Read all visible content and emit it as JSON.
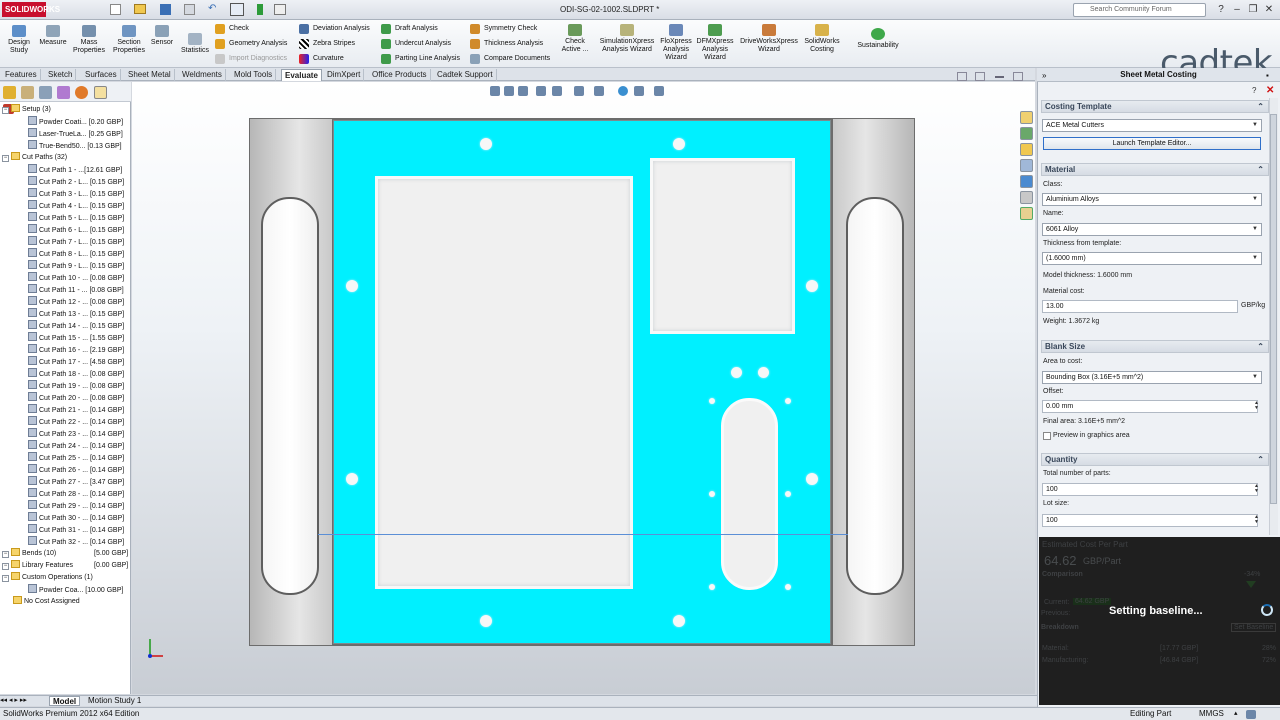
{
  "app": {
    "logo": "SOLIDWORKS",
    "doc_title": "ODI-SG-02-1002.SLDPRT *",
    "search_placeholder": "Search Community Forum",
    "brand": "cadtek"
  },
  "window_buttons": [
    "?",
    "–",
    "❐",
    "✕"
  ],
  "ribbon": {
    "big_buttons": [
      {
        "label": "Design Study"
      },
      {
        "label": "Measure"
      },
      {
        "label": "Mass Properties"
      },
      {
        "label": "Section Properties"
      },
      {
        "label": "Sensor"
      },
      {
        "label": "Statistics"
      }
    ],
    "group1": [
      "Check",
      "Geometry Analysis",
      "Import Diagnostics"
    ],
    "group2": [
      "Deviation Analysis",
      "Zebra Stripes",
      "Curvature"
    ],
    "group3": [
      "Draft Analysis",
      "Undercut Analysis",
      "Parting Line Analysis"
    ],
    "group4": [
      "Symmetry Check",
      "Thickness Analysis",
      "Compare Documents"
    ],
    "right_buttons": [
      {
        "label": "Check Active ..."
      },
      {
        "label": "SimulationXpress Analysis Wizard"
      },
      {
        "label": "FloXpress Analysis Wizard"
      },
      {
        "label": "DFMXpress Analysis Wizard"
      },
      {
        "label": "DriveWorksXpress Wizard"
      },
      {
        "label": "SolidWorks Costing"
      },
      {
        "label": "Sustainability"
      }
    ]
  },
  "tabs": [
    "Features",
    "Sketch",
    "Surfaces",
    "Sheet Metal",
    "Weldments",
    "Mold Tools",
    "Evaluate",
    "DimXpert",
    "Office Products",
    "Cadtek Support"
  ],
  "active_tab": "Evaluate",
  "tree": {
    "setup": {
      "label": "Setup (3)",
      "items": [
        "Powder Coati... [0.20 GBP]",
        "Laser-TrueLa... [0.25 GBP]",
        "True-Bend50... [0.13 GBP]"
      ]
    },
    "cut_paths": {
      "label": "Cut Paths (32)",
      "items": [
        "Cut Path 1 - ...[12.61 GBP]",
        "Cut Path 2 - L... [0.15 GBP]",
        "Cut Path 3 - L... [0.15 GBP]",
        "Cut Path 4 - L... [0.15 GBP]",
        "Cut Path 5 - L... [0.15 GBP]",
        "Cut Path 6 - L... [0.15 GBP]",
        "Cut Path 7 - L... [0.15 GBP]",
        "Cut Path 8 - L... [0.15 GBP]",
        "Cut Path 9 - L... [0.15 GBP]",
        "Cut Path 10 - ... [0.08 GBP]",
        "Cut Path 11 - ... [0.08 GBP]",
        "Cut Path 12 - ... [0.08 GBP]",
        "Cut Path 13 - ... [0.15 GBP]",
        "Cut Path 14 - ... [0.15 GBP]",
        "Cut Path 15 - ... [1.55 GBP]",
        "Cut Path 16 - ... [2.19 GBP]",
        "Cut Path 17 - ... [4.58 GBP]",
        "Cut Path 18 - ... [0.08 GBP]",
        "Cut Path 19 - ... [0.08 GBP]",
        "Cut Path 20 - ... [0.08 GBP]",
        "Cut Path 21 - ... [0.14 GBP]",
        "Cut Path 22 - ... [0.14 GBP]",
        "Cut Path 23 - ... [0.14 GBP]",
        "Cut Path 24 - ... [0.14 GBP]",
        "Cut Path 25 - ... [0.14 GBP]",
        "Cut Path 26 - ... [0.14 GBP]",
        "Cut Path 27 - ... [3.47 GBP]",
        "Cut Path 28 - ... [0.14 GBP]",
        "Cut Path 29 - ... [0.14 GBP]",
        "Cut Path 30 - ... [0.14 GBP]",
        "Cut Path 31 - ... [0.14 GBP]",
        "Cut Path 32 - ... [0.14 GBP]"
      ]
    },
    "bends": {
      "label": "Bends (10)",
      "value": "[5.00 GBP]"
    },
    "library": {
      "label": "Library Features",
      "value": "[0.00 GBP]"
    },
    "custom": {
      "label": "Custom Operations (1)",
      "items": [
        "Powder Coa... [10.00 GBP]"
      ]
    },
    "no_cost": "No Cost Assigned"
  },
  "bottom_tabs": [
    "Model",
    "Motion Study 1"
  ],
  "status": {
    "left": "SolidWorks Premium 2012 x64 Edition",
    "mode": "Editing Part",
    "units": "MMGS"
  },
  "costing": {
    "title": "Sheet Metal Costing",
    "template_section": "Costing Template",
    "template": "ACE Metal Cutters",
    "launch": "Launch Template Editor...",
    "material_section": "Material",
    "class_label": "Class:",
    "class": "Aluminium Alloys",
    "name_label": "Name:",
    "name": "6061 Alloy",
    "thick_label": "Thickness from template:",
    "thickness": "(1.6000 mm)",
    "model_thickness": "Model thickness: 1.6000 mm",
    "cost_label": "Material cost:",
    "cost": "13.00",
    "cost_unit": "GBP/kg",
    "weight": "Weight: 1.3672 kg",
    "blank_section": "Blank Size",
    "area_label": "Area to cost:",
    "area": "Bounding Box (3.16E+5 mm^2)",
    "offset_label": "Offset:",
    "offset": "0.00 mm",
    "final_area": "Final area: 3.16E+5 mm^2",
    "preview": "Preview in graphics area",
    "qty_section": "Quantity",
    "total_label": "Total number of parts:",
    "total": "100",
    "lot_label": "Lot size:",
    "lot": "100",
    "est_title": "Estimated Cost Per Part",
    "est_value": "64.62",
    "est_unit": "GBP/Part",
    "comparison": "Comparison",
    "pct": "-34%",
    "current": "Current:",
    "current_val": "64.62 GBP",
    "previous": "Previous:",
    "set_baseline": "Set Baseline",
    "breakdown": "Breakdown",
    "mat_row": "Material:",
    "mat_val": "[17.77 GBP]",
    "mat_pct": "28%",
    "man_row": "Manufacturing:",
    "man_val": "[46.84 GBP]",
    "man_pct": "72%",
    "overlay": "Setting baseline..."
  }
}
